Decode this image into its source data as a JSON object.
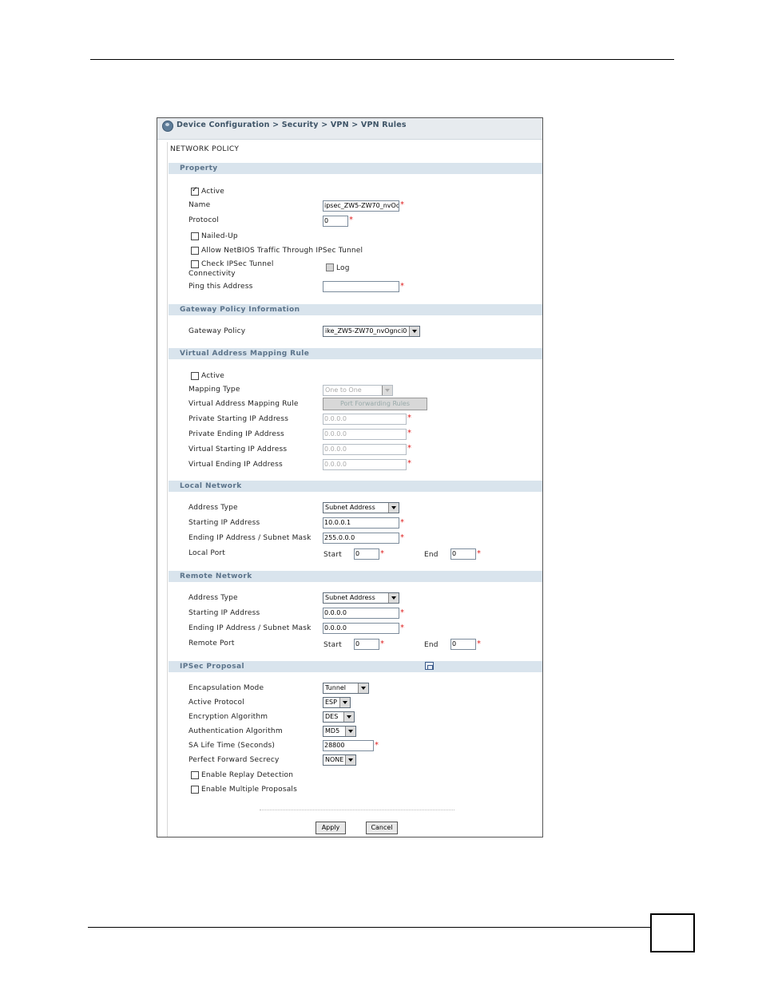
{
  "breadcrumb": "Device Configuration > Security > VPN > VPN Rules",
  "page_title": "NETWORK POLICY",
  "required_mark": "*",
  "sections": {
    "property": "Property",
    "gateway": "Gateway Policy Information",
    "virtual": "Virtual Address Mapping Rule",
    "local": "Local Network",
    "remote": "Remote Network",
    "ipsec": "IPSec Proposal"
  },
  "property": {
    "active_label": "Active",
    "name_label": "Name",
    "name_value": "ipsec_ZW5-ZW70_nvOc",
    "protocol_label": "Protocol",
    "protocol_value": "0",
    "nailed_label": "Nailed-Up",
    "netbios_label": "Allow NetBIOS Traffic Through IPSec Tunnel",
    "check_label_1": "Check IPSec Tunnel",
    "check_label_2": "Connectivity",
    "log_label": "Log",
    "ping_label": "Ping this Address",
    "ping_value": ""
  },
  "gateway": {
    "policy_label": "Gateway Policy",
    "policy_value": "ike_ZW5-ZW70_nvOgnci0"
  },
  "virtual": {
    "active_label": "Active",
    "mapping_type_label": "Mapping Type",
    "mapping_type_value": "One to One",
    "rule_label": "Virtual Address Mapping Rule",
    "rule_button": "Port Forwarding Rules",
    "priv_start_label": "Private Starting IP Address",
    "priv_start_value": "0.0.0.0",
    "priv_end_label": "Private Ending IP Address",
    "priv_end_value": "0.0.0.0",
    "virt_start_label": "Virtual Starting IP Address",
    "virt_start_value": "0.0.0.0",
    "virt_end_label": "Virtual Ending IP Address",
    "virt_end_value": "0.0.0.0"
  },
  "local": {
    "addr_type_label": "Address Type",
    "addr_type_value": "Subnet Address",
    "start_ip_label": "Starting IP Address",
    "start_ip_value": "10.0.0.1",
    "end_ip_label": "Ending IP Address / Subnet Mask",
    "end_ip_value": "255.0.0.0",
    "port_label": "Local Port",
    "start_label": "Start",
    "start_value": "0",
    "end_label": "End",
    "end_value": "0"
  },
  "remote": {
    "addr_type_label": "Address Type",
    "addr_type_value": "Subnet Address",
    "start_ip_label": "Starting IP Address",
    "start_ip_value": "0.0.0.0",
    "end_ip_label": "Ending IP Address / Subnet Mask",
    "end_ip_value": "0.0.0.0",
    "port_label": "Remote Port",
    "start_label": "Start",
    "start_value": "0",
    "end_label": "End",
    "end_value": "0"
  },
  "ipsec": {
    "encap_label": "Encapsulation Mode",
    "encap_value": "Tunnel",
    "protocol_label": "Active Protocol",
    "protocol_value": "ESP",
    "encrypt_label": "Encryption Algorithm",
    "encrypt_value": "DES",
    "auth_label": "Authentication Algorithm",
    "auth_value": "MD5",
    "sa_label": "SA Life Time (Seconds)",
    "sa_value": "28800",
    "pfs_label": "Perfect Forward Secrecy",
    "pfs_value": "NONE",
    "replay_label": "Enable Replay Detection",
    "multi_label": "Enable Multiple Proposals"
  },
  "buttons": {
    "apply": "Apply",
    "cancel": "Cancel"
  },
  "checks": {
    "property_active": true,
    "nailed_up": false,
    "netbios": false,
    "check_tunnel": false,
    "log": false,
    "virtual_active": false,
    "replay": false,
    "multiple": false
  }
}
